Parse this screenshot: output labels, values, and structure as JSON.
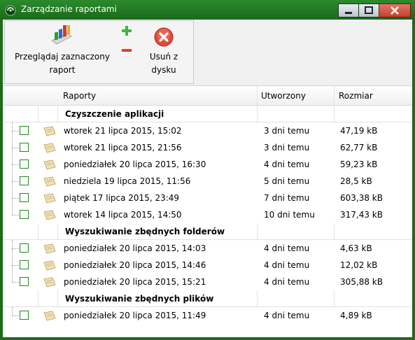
{
  "window": {
    "title": "Zarządzanie raportami",
    "controls": [
      "minimize",
      "maximize",
      "close"
    ]
  },
  "toolbar": {
    "browse_label": "Przeglądaj zaznaczony raport",
    "delete_label": "Usuń z dysku",
    "icons": {
      "browse": "bar-chart-report-icon",
      "add": "plus-icon",
      "remove": "minus-icon",
      "delete": "red-x-circle-icon"
    }
  },
  "columns": {
    "reports": "Raporty",
    "created": "Utworzony",
    "size": "Rozmiar"
  },
  "groups": [
    {
      "name": "Czyszczenie aplikacji",
      "items": [
        {
          "date": "wtorek 21 lipca 2015, 15:02",
          "created": "3 dni temu",
          "size": "47,19 kB"
        },
        {
          "date": "wtorek 21 lipca 2015, 21:56",
          "created": "3 dni temu",
          "size": "62,77 kB"
        },
        {
          "date": "poniedziałek 20 lipca 2015, 16:30",
          "created": "4 dni temu",
          "size": "59,23 kB"
        },
        {
          "date": "niedziela 19 lipca 2015, 11:56",
          "created": "5 dni temu",
          "size": "28,5 kB"
        },
        {
          "date": "piątek 17 lipca 2015, 23:49",
          "created": "7 dni temu",
          "size": "603,38 kB"
        },
        {
          "date": "wtorek 14 lipca 2015, 14:50",
          "created": "10 dni temu",
          "size": "317,43 kB"
        }
      ]
    },
    {
      "name": "Wyszukiwanie zbędnych folderów",
      "items": [
        {
          "date": "poniedziałek 20 lipca 2015, 14:03",
          "created": "4 dni temu",
          "size": "4,63 kB"
        },
        {
          "date": "poniedziałek 20 lipca 2015, 14:46",
          "created": "4 dni temu",
          "size": "12,02 kB"
        },
        {
          "date": "poniedziałek 20 lipca 2015, 15:21",
          "created": "4 dni temu",
          "size": "305,88 kB"
        }
      ]
    },
    {
      "name": "Wyszukiwanie zbędnych plików",
      "items": [
        {
          "date": "poniedziałek 20 lipca 2015, 11:49",
          "created": "4 dni temu",
          "size": "4,89 kB"
        }
      ]
    }
  ],
  "colors": {
    "frame": "#1e6b1e",
    "checkbox_border": "#1d8a1d",
    "close_button": "#c94a38"
  }
}
